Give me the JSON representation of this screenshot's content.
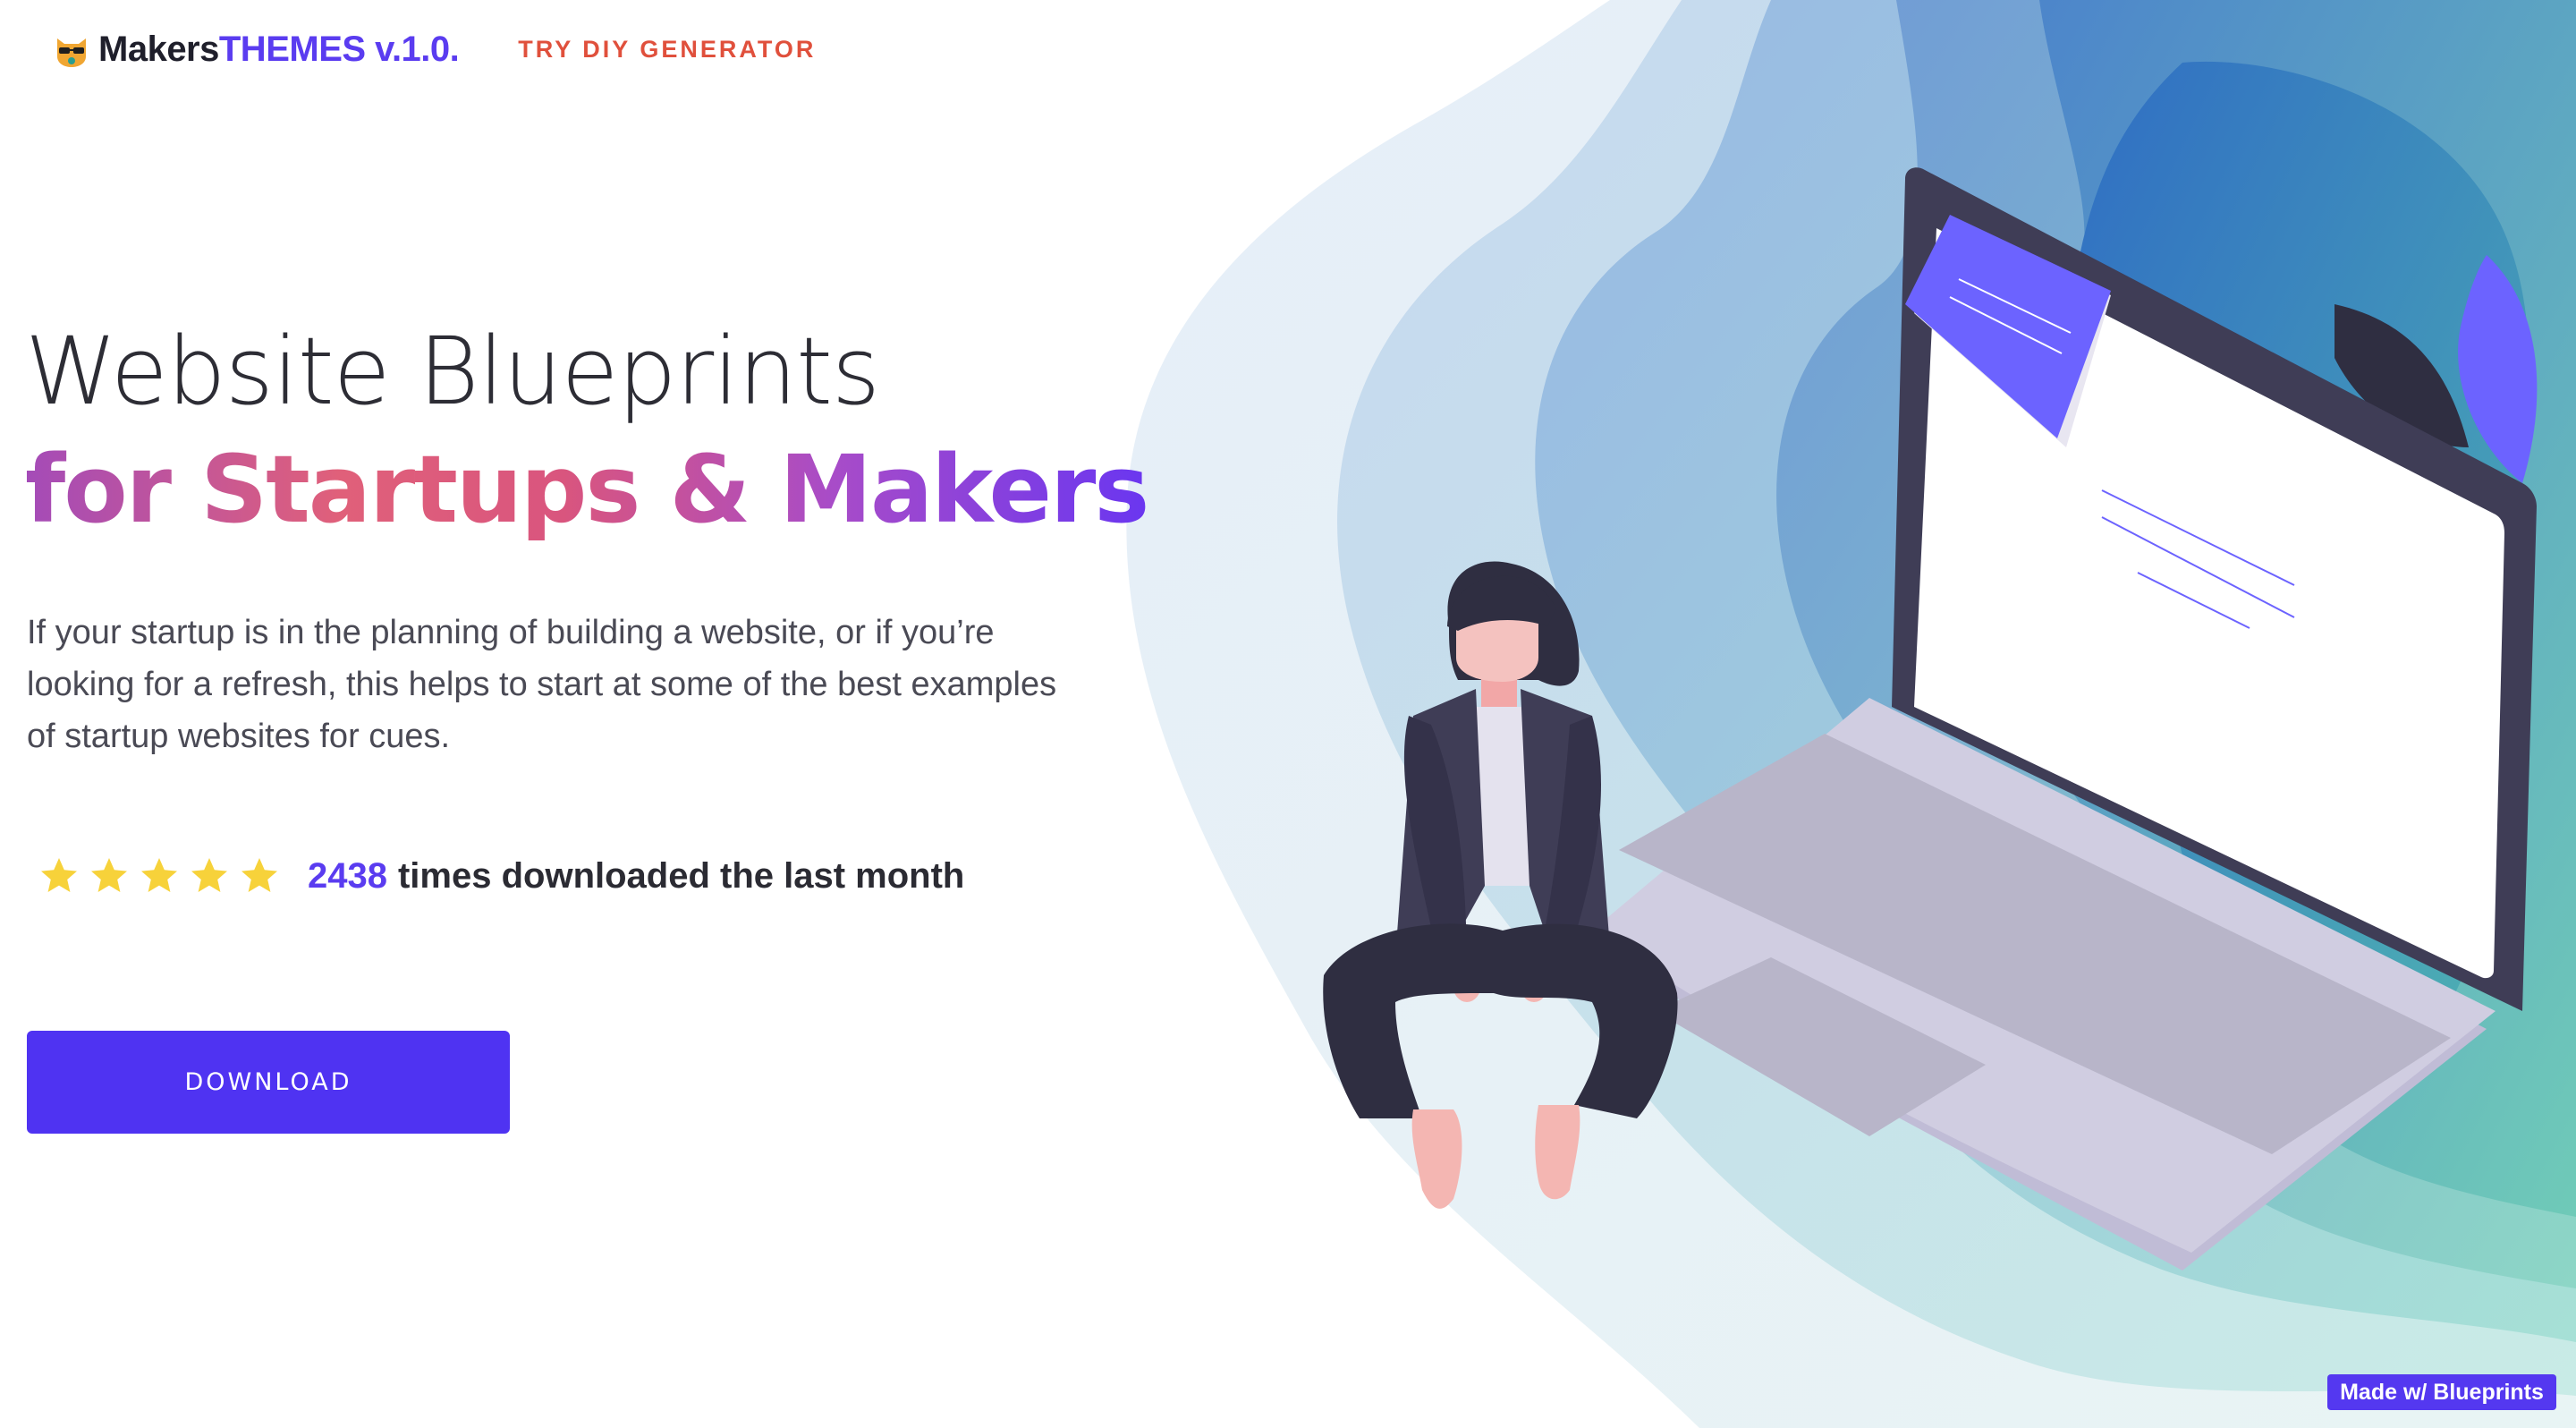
{
  "header": {
    "logo_part1": "Makers",
    "logo_part2": "THEMES v.1.0.",
    "logo_icon": "cat-sunglasses-icon",
    "nav_link": "TRY DIY GENERATOR"
  },
  "hero": {
    "title_line1": "Website Blueprints",
    "title_line2": "for Startups & Makers",
    "description": "If your startup is in the planning of building a website, or if you’re looking for a refresh, this helps to start at some of the best examples of startup websites for cues.",
    "rating": {
      "stars": 5,
      "count": "2438",
      "label": "times downloaded the last month"
    },
    "download_button": "DOWNLOAD"
  },
  "badge": "Made w/ Blueprints",
  "colors": {
    "accent": "#4f33f2",
    "nav_link": "#e0503c",
    "star": "#f7d23a",
    "laptop_screen_bezel": "#3f3d56",
    "laptop_body": "#d0cde1"
  }
}
